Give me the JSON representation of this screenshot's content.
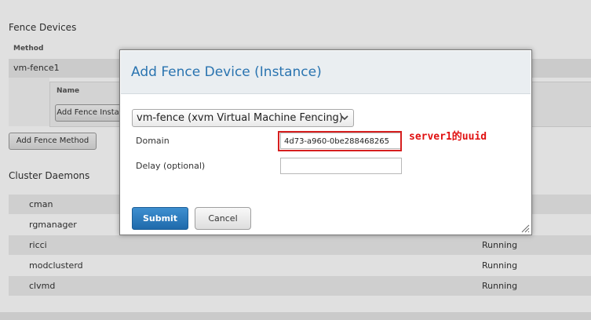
{
  "background": {
    "fence_devices_title": "Fence Devices",
    "method_header": "Method",
    "method_name": "vm-fence1",
    "instance_name_header": "Name",
    "add_fence_instance_label": "Add Fence Instance",
    "add_fence_method_label": "Add Fence Method",
    "cluster_daemons_title": "Cluster Daemons",
    "daemons": [
      {
        "name": "cman",
        "status": ""
      },
      {
        "name": "rgmanager",
        "status": ""
      },
      {
        "name": "ricci",
        "status": "Running"
      },
      {
        "name": "modclusterd",
        "status": "Running"
      },
      {
        "name": "clvmd",
        "status": "Running"
      }
    ]
  },
  "modal": {
    "title": "Add Fence Device (Instance)",
    "device_type_selected": "vm-fence (xvm Virtual Machine Fencing)",
    "domain_label": "Domain",
    "domain_value": "4d73-a960-0be288468265",
    "delay_label": "Delay (optional)",
    "delay_value": "",
    "submit_label": "Submit",
    "cancel_label": "Cancel"
  },
  "annotation": {
    "text": "server1的uuid",
    "color": "#e01010"
  },
  "colors": {
    "accent": "#2a74b0",
    "submit_bg": "#2b7bc0",
    "highlight": "#d61f1f"
  }
}
